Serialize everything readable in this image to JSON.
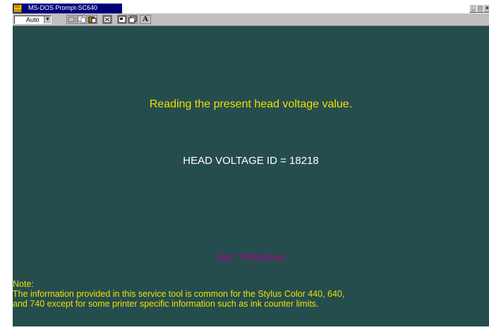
{
  "window": {
    "title": "MS-DOS Prompt-SC640",
    "icon_label": "MS DOS",
    "controls": [
      "_",
      "□",
      "×"
    ]
  },
  "toolbar": {
    "font_size_value": "Auto",
    "buttons": [
      "mark-icon",
      "copy-icon",
      "paste-icon",
      "fullscreen-icon",
      "properties-icon",
      "background-icon",
      "font-icon"
    ],
    "font_button_label": "A"
  },
  "console": {
    "reading_line": "Reading the present head voltage value.",
    "voltage_line": "HEAD VOLTAGE ID = 18218",
    "esc_line": "Esc:  Previous",
    "note_heading": "Note:",
    "note_line_1": "The information provided in this service tool is common for the Stylus Color 440, 640,",
    "note_line_2": "and 740 except for some printer specific information such as ink counter limits.",
    "colors": {
      "background": "#254d4e",
      "yellow": "#f0e000",
      "white": "#ffffff",
      "magenta": "#b2008a"
    }
  }
}
